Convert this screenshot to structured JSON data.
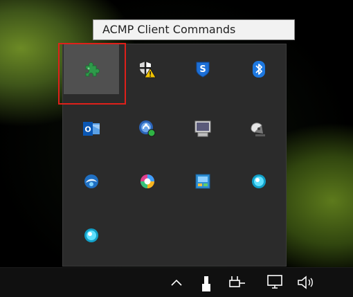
{
  "tooltip": {
    "text": "ACMP Client Commands"
  },
  "tray_flyout": {
    "icons": [
      {
        "name": "acmp-client-commands-icon",
        "hovered": true
      },
      {
        "name": "security-center-warning-icon"
      },
      {
        "name": "sophos-shield-icon"
      },
      {
        "name": "bluetooth-icon"
      },
      {
        "name": "outlook-icon"
      },
      {
        "name": "remote-support-icon"
      },
      {
        "name": "display-icon"
      },
      {
        "name": "satellite-dish-icon"
      },
      {
        "name": "blue-swirl-orb-icon"
      },
      {
        "name": "rainbow-orb-icon"
      },
      {
        "name": "control-panel-tile-icon"
      },
      {
        "name": "blue-orb-icon"
      },
      {
        "name": "blue-orb-icon-2"
      }
    ]
  },
  "taskbar": {
    "icons": [
      {
        "name": "chevron-up-icon"
      },
      {
        "name": "usb-drive-icon"
      },
      {
        "name": "power-plug-icon"
      },
      {
        "name": "network-monitor-icon"
      },
      {
        "name": "speaker-volume-icon"
      }
    ]
  },
  "colors": {
    "tooltip_bg": "#f2f2f2",
    "flyout_bg": "#2b2b2b",
    "hover_bg": "#505050",
    "selection_red": "#e0201a",
    "taskbar_bg": "#101010"
  }
}
